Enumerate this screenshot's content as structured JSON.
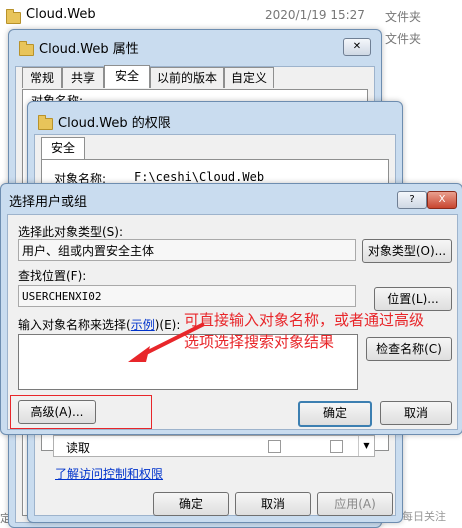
{
  "explorer": {
    "folder_name": "Cloud.Web",
    "date": "2020/1/19 15:27",
    "type": "文件夹",
    "type2": "文件夹",
    "left_crop": "定下",
    "right_crop": "每日关注"
  },
  "properties_window": {
    "title": "Cloud.Web 属性",
    "tabs": [
      "常规",
      "共享",
      "安全",
      "以前的版本",
      "自定义"
    ],
    "active_tab": "安全",
    "obj_label_partial": "对象名称:"
  },
  "permissions_window": {
    "title": "Cloud.Web 的权限",
    "tab": "安全",
    "object_name_label": "对象名称:",
    "object_name_value": "F:\\ceshi\\Cloud.Web",
    "perm_row_label": "读取",
    "link": "了解访问控制和权限",
    "ok": "确定",
    "cancel": "取消",
    "apply": "应用(A)"
  },
  "select_dialog": {
    "title": "选择用户或组",
    "help_btn": "?",
    "close_btn": "X",
    "object_type_label": "选择此对象类型(S):",
    "object_type_value": "用户、组或内置安全主体",
    "object_type_button": "对象类型(O)...",
    "location_label": "查找位置(F):",
    "location_value": "USERCHENXI02",
    "location_button": "位置(L)...",
    "enter_label": "输入对象名称来选择(",
    "enter_link": "示例",
    "enter_label_tail": ")(E):",
    "check_names_button": "检查名称(C)",
    "advanced_button": "高级(A)...",
    "ok_button": "确定",
    "cancel_button": "取消"
  },
  "annotation": {
    "line1": "可直接输入对象名称，或者通过高级",
    "line2": "选项选择搜索对象结果"
  },
  "colors": {
    "accent_red": "#e8262a",
    "link_blue": "#0033cc",
    "dialog_title_bar": "#c9dcef"
  }
}
